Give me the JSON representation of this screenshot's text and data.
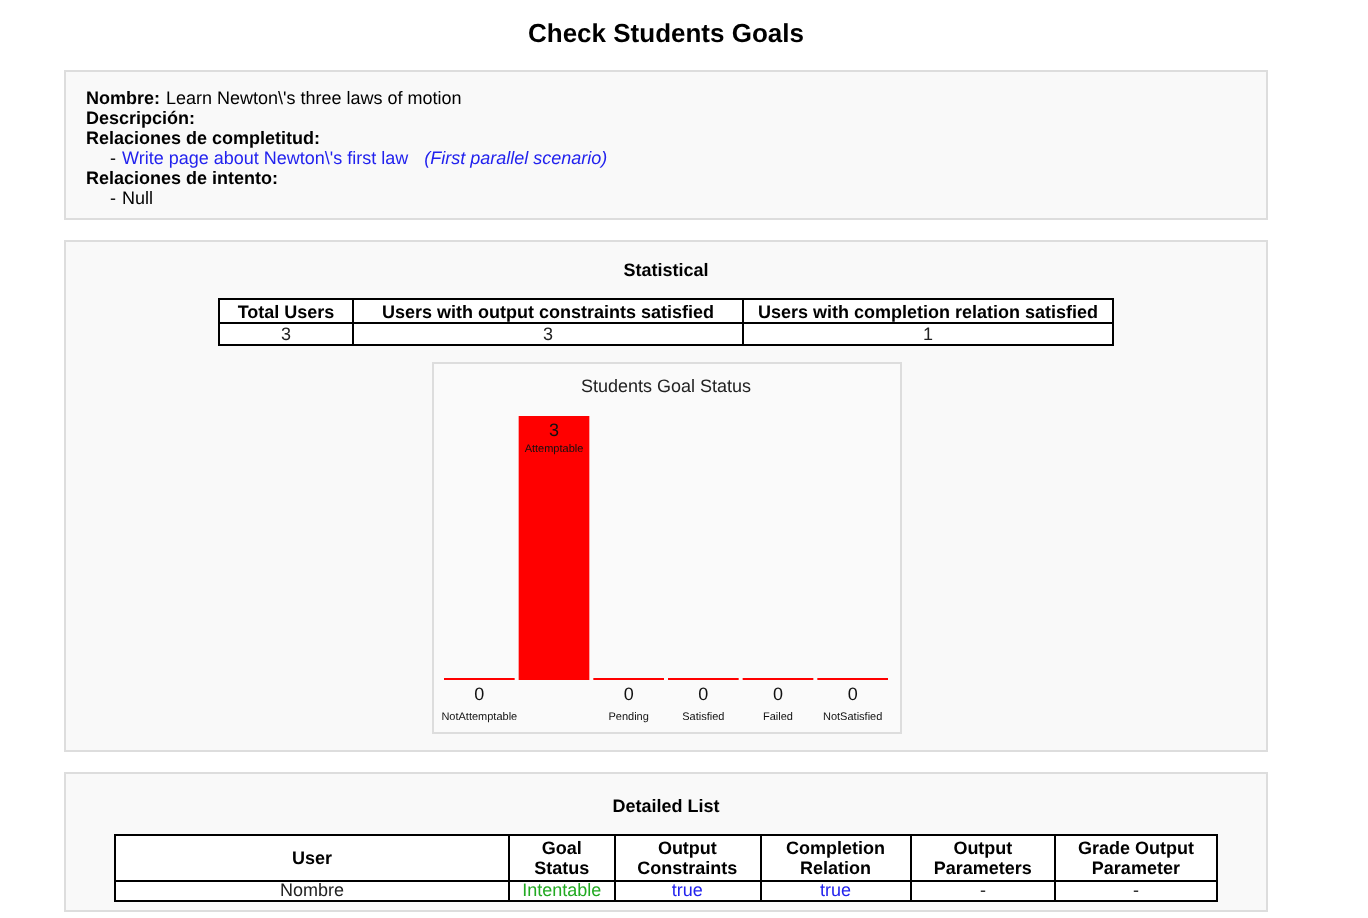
{
  "page_title": "Check Students Goals",
  "goal": {
    "fields": [
      {
        "kind": "text",
        "label": "Nombre:",
        "value": "Learn Newton\\'s three laws of motion"
      },
      {
        "kind": "text",
        "label": "Descripción:"
      },
      {
        "kind": "list",
        "label": "Relaciones de completitud:",
        "items": [
          {
            "dash": "-",
            "link": "Write page about Newton\\'s first law",
            "note": "(First parallel scenario)"
          }
        ]
      },
      {
        "kind": "list",
        "label": "Relaciones de intento:",
        "items": [
          {
            "dash": "-",
            "text": "Null"
          }
        ]
      }
    ]
  },
  "statistical": {
    "title": "Statistical",
    "columns": [
      "Total Users",
      "Users with output constraints satisfied",
      "Users with completion relation satisfied"
    ],
    "row": [
      "3",
      "3",
      "1"
    ],
    "chart_data": {
      "type": "bar",
      "title": "Students Goal Status",
      "categories": [
        "NotAttemptable",
        "Attemptable",
        "Pending",
        "Satisfied",
        "Failed",
        "NotSatisfied"
      ],
      "series": [
        {
          "color": "#ff0000",
          "values": [
            0,
            3,
            0,
            0,
            0,
            0
          ]
        }
      ],
      "data_labels": true
    }
  },
  "detailed": {
    "title": "Detailed List",
    "columns": [
      "User",
      "Goal Status",
      "Output Constraints",
      "Completion Relation",
      "Output Parameters",
      "Grade Output Parameter"
    ],
    "rows": [
      [
        "Nombre",
        "Intentable",
        "true",
        "true",
        "-",
        "-"
      ]
    ]
  }
}
